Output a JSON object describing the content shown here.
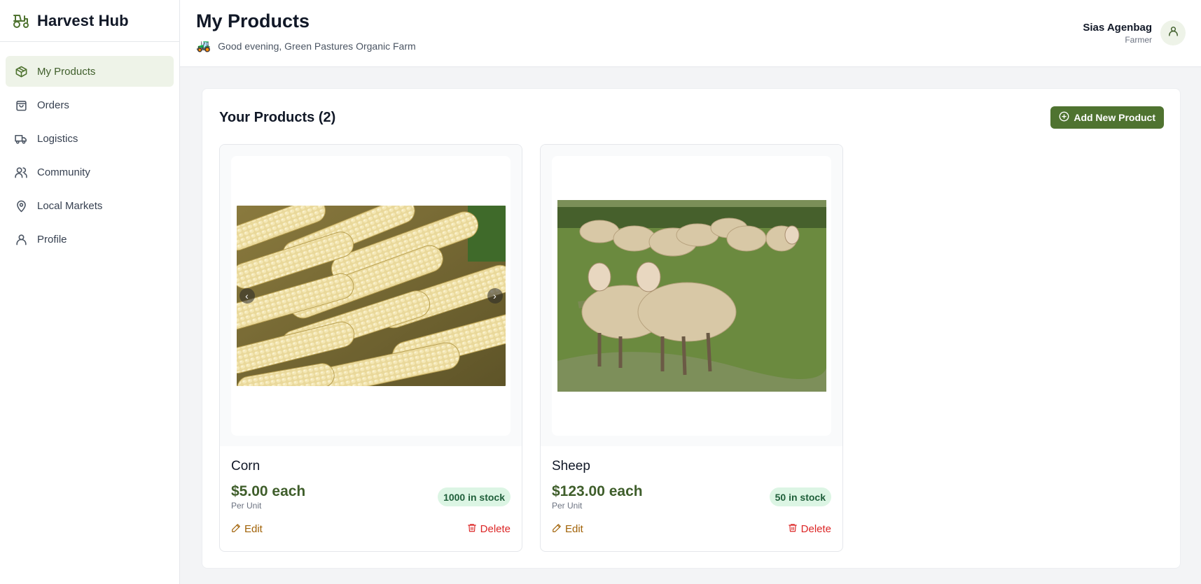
{
  "brand": {
    "name": "Harvest Hub",
    "icon": "tractor-icon"
  },
  "sidebar": {
    "items": [
      {
        "label": "My Products",
        "icon": "package-icon",
        "active": true
      },
      {
        "label": "Orders",
        "icon": "shopping-bag-icon",
        "active": false
      },
      {
        "label": "Logistics",
        "icon": "truck-icon",
        "active": false
      },
      {
        "label": "Community",
        "icon": "users-icon",
        "active": false
      },
      {
        "label": "Local Markets",
        "icon": "map-pin-icon",
        "active": false
      },
      {
        "label": "Profile",
        "icon": "user-icon",
        "active": false
      }
    ]
  },
  "header": {
    "title": "My Products",
    "greeting_emoji": "🚜",
    "greeting": "Good evening, Green Pastures Organic Farm",
    "user": {
      "name": "Sias Agenbag",
      "role": "Farmer"
    }
  },
  "panel": {
    "title": "Your Products (2)",
    "add_button_label": "Add New Product"
  },
  "products": [
    {
      "name": "Corn",
      "price": "$5.00 each",
      "unit": "Per Unit",
      "stock": "1000 in stock",
      "edit_label": "Edit",
      "delete_label": "Delete",
      "has_carousel": true
    },
    {
      "name": "Sheep",
      "price": "$123.00 each",
      "unit": "Per Unit",
      "stock": "50 in stock",
      "edit_label": "Edit",
      "delete_label": "Delete",
      "has_carousel": false
    }
  ],
  "colors": {
    "brand_green": "#4f7330",
    "active_bg": "#eef3e8",
    "price_green": "#3f5e2b",
    "stock_bg": "#dcf5e4",
    "edit": "#a16207",
    "delete": "#dc2626"
  }
}
